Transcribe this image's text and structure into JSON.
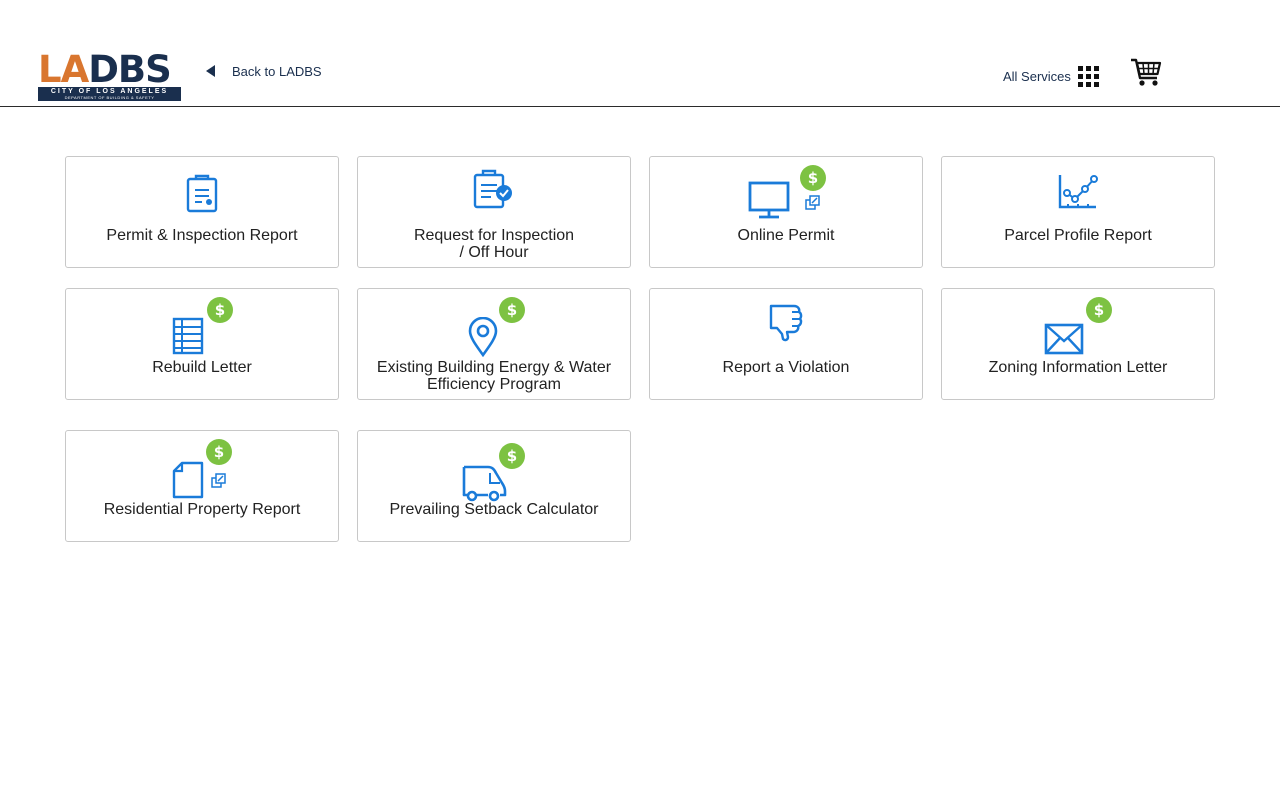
{
  "header": {
    "logo": {
      "main": "LADBS",
      "line1": "CITY OF LOS ANGELES",
      "line2": "DEPARTMENT OF BUILDING & SAFETY"
    },
    "back_label": "Back to LADBS",
    "all_services_label": "All Services"
  },
  "colors": {
    "icon_blue": "#1a7bd9",
    "fee_green": "#7dc242",
    "brand_navy": "#1a2f4e",
    "brand_orange": "#d9762f"
  },
  "services": [
    {
      "label": "Permit & Inspection Report",
      "icon": "clipboard-icon",
      "has_fee": false,
      "external": false
    },
    {
      "label": "Request for Inspection / Off Hour",
      "icon": "clipboard-check-icon",
      "has_fee": false,
      "external": false
    },
    {
      "label": "Online Permit",
      "icon": "monitor-icon",
      "has_fee": true,
      "external": true
    },
    {
      "label": "Parcel Profile Report",
      "icon": "line-chart-icon",
      "has_fee": false,
      "external": false
    },
    {
      "label": "Rebuild Letter",
      "icon": "document-list-icon",
      "has_fee": true,
      "external": false
    },
    {
      "label": "Existing Building Energy & Water Efficiency Program",
      "icon": "map-pin-icon",
      "has_fee": true,
      "external": false
    },
    {
      "label": "Report a Violation",
      "icon": "thumbs-down-icon",
      "has_fee": false,
      "external": false
    },
    {
      "label": "Zoning Information Letter",
      "icon": "envelope-icon",
      "has_fee": true,
      "external": false
    },
    {
      "label": "Residential Property Report",
      "icon": "file-icon",
      "has_fee": true,
      "external": true
    },
    {
      "label": "Prevailing Setback Calculator",
      "icon": "truck-icon",
      "has_fee": true,
      "external": false
    }
  ],
  "fee_symbol": "$"
}
